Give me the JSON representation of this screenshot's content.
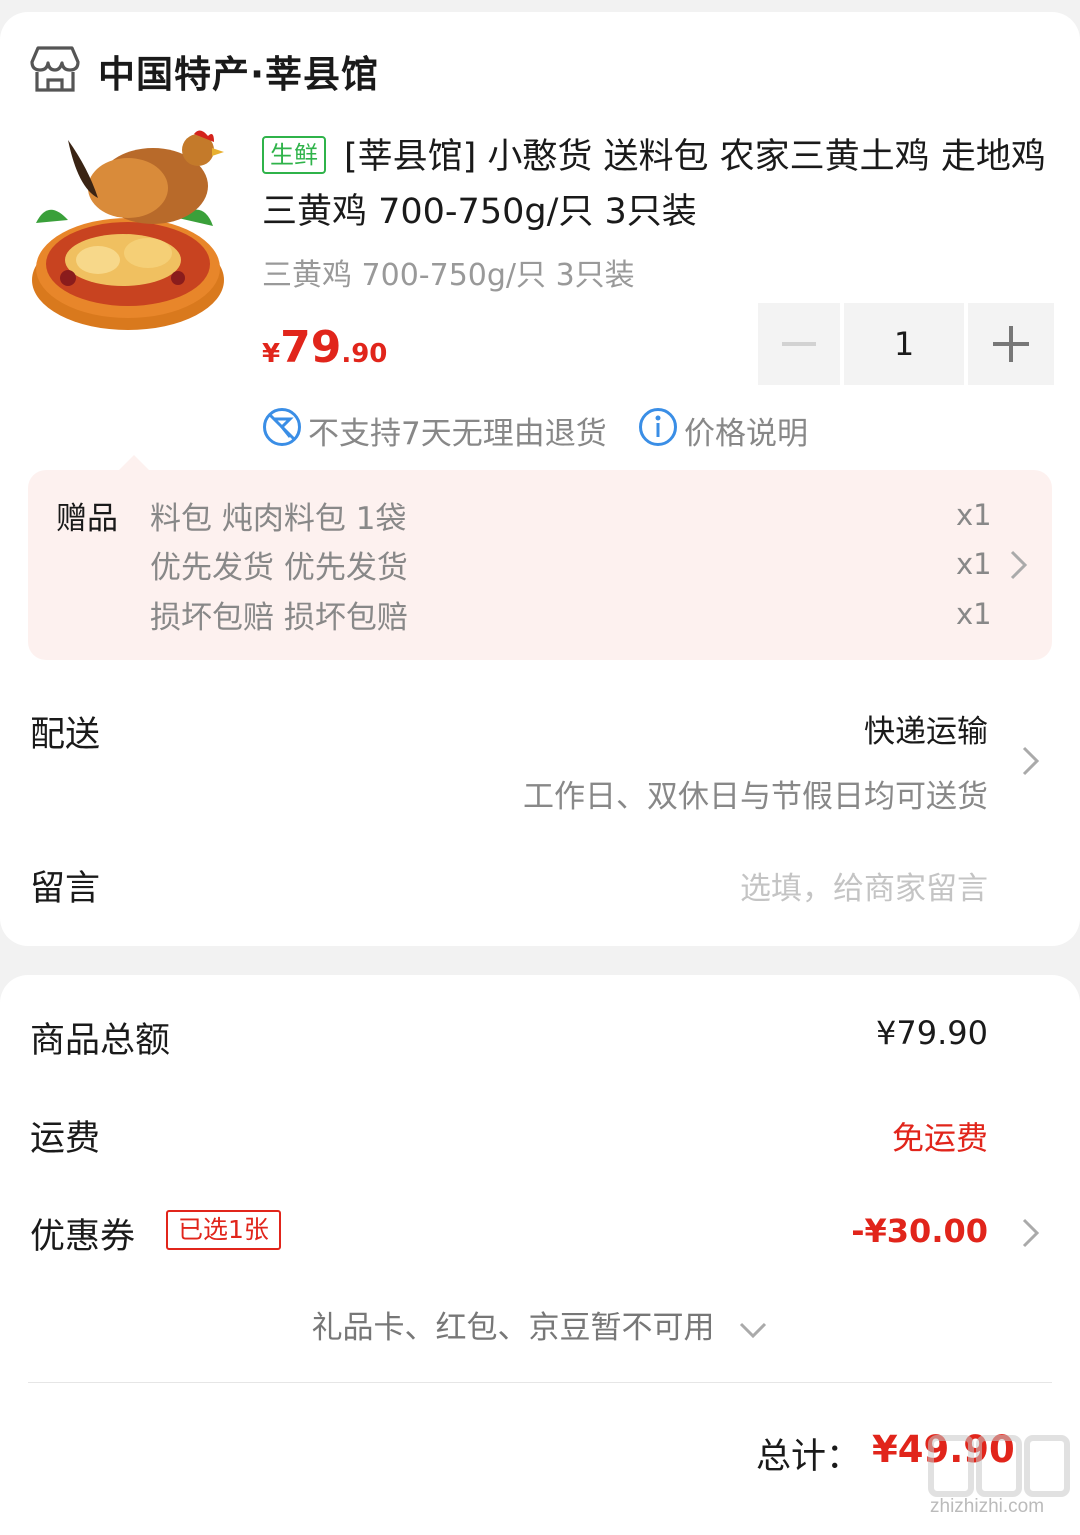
{
  "shop": {
    "name": "中国特产·莘县馆",
    "icon": "store-icon"
  },
  "product": {
    "tag": "生鲜",
    "title": "[莘县馆] 小憨货 送料包 农家三黄土鸡 走地鸡 三黄鸡 700-750g/只 3只装",
    "spec": "三黄鸡 700-750g/只 3只装",
    "price_symbol": "¥",
    "price_int": "79",
    "price_dec": ".90",
    "quantity": "1",
    "policy_no_return": "不支持7天无理由退货",
    "policy_price_note": "价格说明"
  },
  "gifts": {
    "label": "赠品",
    "items": [
      {
        "name": "料包 炖肉料包 1袋",
        "qty": "x1"
      },
      {
        "name": "优先发货 优先发货",
        "qty": "x1"
      },
      {
        "name": "损坏包赔 损坏包赔",
        "qty": "x1"
      }
    ]
  },
  "delivery": {
    "label": "配送",
    "method": "快递运输",
    "note": "工作日、双休日与节假日均可送货"
  },
  "message": {
    "label": "留言",
    "placeholder": "选填，给商家留言"
  },
  "summary": {
    "goods_total_label": "商品总额",
    "goods_total_value": "¥79.90",
    "shipping_label": "运费",
    "shipping_value": "免运费",
    "coupon_label": "优惠券",
    "coupon_tag": "已选1张",
    "coupon_value": "-¥30.00",
    "unavailable_text": "礼品卡、红包、京豆暂不可用",
    "total_label": "总计：",
    "total_value": "¥49.90"
  },
  "watermark": {
    "text": "zhizhizhi.com"
  },
  "colors": {
    "accent": "#e1251b",
    "fresh": "#2fb34a",
    "policy_icon": "#3a8ee6"
  }
}
